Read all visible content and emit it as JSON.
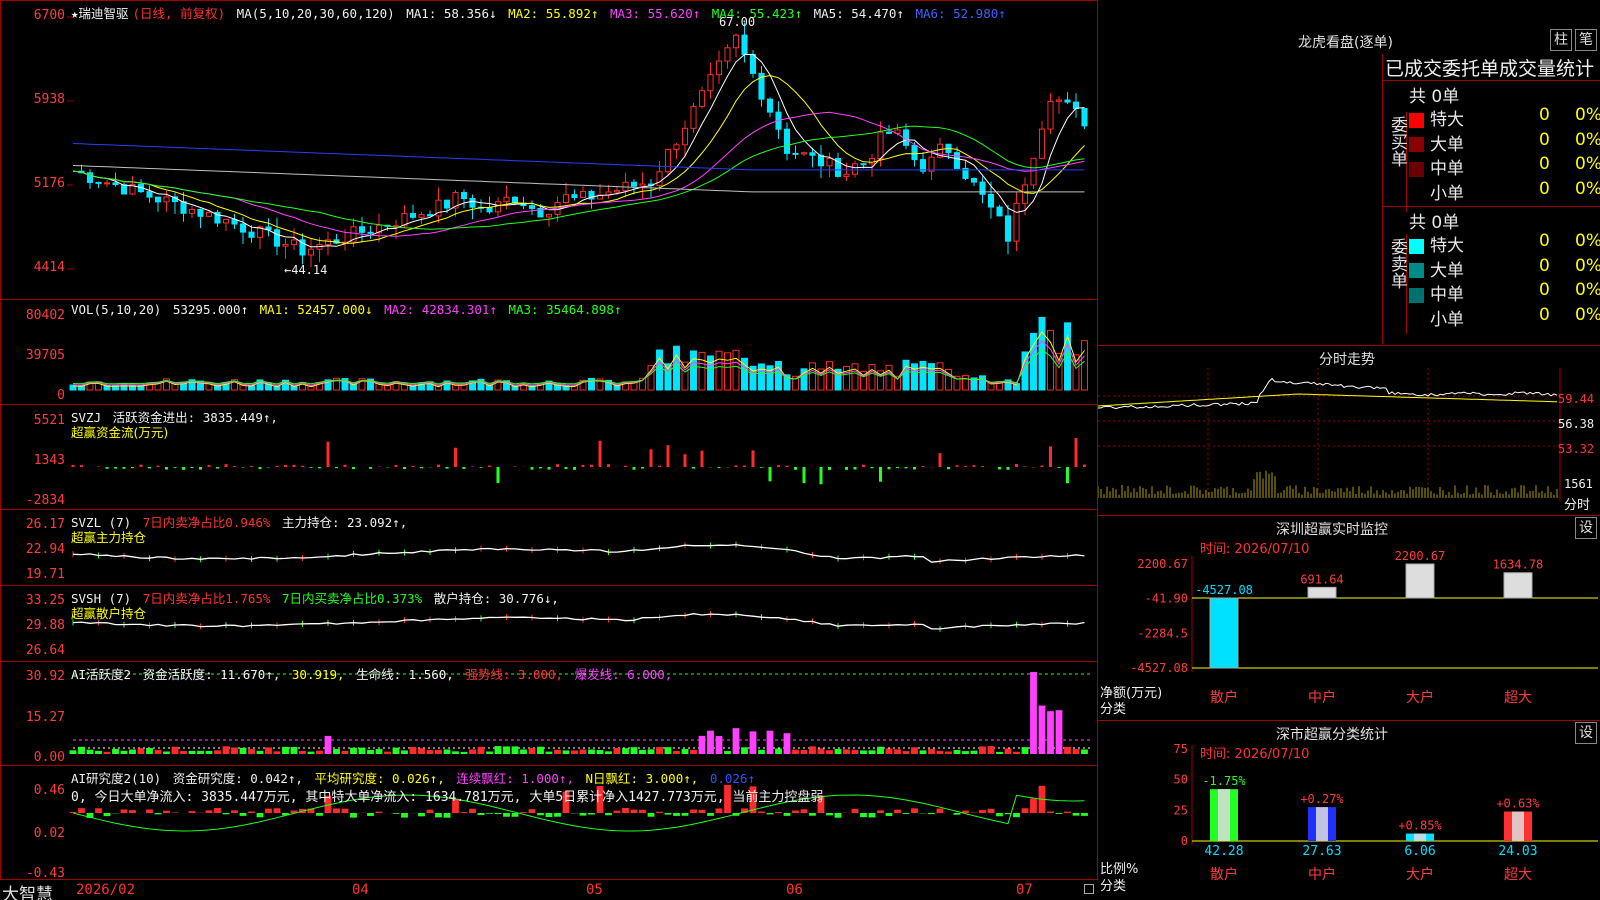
{
  "colors": {
    "up": "#ff2a2a",
    "down": "#00e4ff",
    "grid": "#a00000",
    "ma1": "#ffffff",
    "ma2": "#ffff00",
    "ma3": "#ff40ff",
    "ma4": "#22ff22",
    "ma5": "#c0c0c0",
    "ma6": "#2a3cff"
  },
  "main": {
    "title": "★瑞迪智驱",
    "mode": "(日线, 前复权)",
    "ma_label": "MA(5,10,20,30,60,120)",
    "ma1": "MA1: 58.356↓",
    "ma2": "MA2: 55.892↑",
    "ma3": "MA3: 55.620↑",
    "ma4": "MA4: 55.423↑",
    "ma5": "MA5: 54.470↑",
    "ma6": "MA6: 52.980↑",
    "y_labels": [
      "6700",
      "5938",
      "5176",
      "4414"
    ],
    "high_note": "67.00",
    "low_note": "←44.14"
  },
  "vol": {
    "label": "VOL(5,10,20)",
    "value": "53295.000↑",
    "ma1": "MA1: 52457.000↓",
    "ma2": "MA2: 42834.301↑",
    "ma3": "MA3: 35464.898↑",
    "y_labels": [
      "80402",
      "39705",
      "0"
    ]
  },
  "svzj": {
    "label": "SVZJ",
    "text": "活跃资金进出: 3835.449↑,",
    "sub": "超赢资金流(万元)",
    "y_labels": [
      "5521",
      "1343",
      "-2834"
    ]
  },
  "svzl": {
    "label": "SVZL (7)",
    "red_text": "7日内卖净占比0.946%",
    "white_text": "主力持仓: 23.092↑,",
    "sub": "超赢主力持仓",
    "y_labels": [
      "26.17",
      "22.94",
      "19.71"
    ]
  },
  "svsh": {
    "label": "SVSH (7)",
    "red_text": "7日内卖净占比1.765%",
    "green_text": "7日内买卖净占比0.373%",
    "white_text": "散户持仓: 30.776↓,",
    "sub": "超赢散户持仓",
    "y_labels": [
      "33.25",
      "29.88",
      "26.64"
    ]
  },
  "ai1": {
    "label": "AI活跃度2",
    "t1": "资金活跃度: 11.670↑,",
    "t2": "30.919,",
    "t3": "生命线: 1.560,",
    "t4": "强势线: 3.000,",
    "t5": "爆发线: 6.000,",
    "y_labels": [
      "30.92",
      "15.27",
      "0.00"
    ]
  },
  "ai2": {
    "label": "AI研究度2(10)",
    "t1": "资金研究度: 0.042↑,",
    "t2": "平均研究度: 0.026↑,",
    "t3": "连续飘红: 1.000↑,",
    "t4": "N日飘红: 3.000↑,",
    "t5": "0.026↑",
    "line2": "0, 今日大单净流入: 3835.447万元, 其中特大单净流入: 1634.781万元, 大单5日累计净入1427.773万元, 当前主力控盘弱",
    "y_labels": [
      "0.46",
      "0.02",
      "-0.43"
    ]
  },
  "bottom": {
    "brand": "大智慧",
    "months": [
      "2026/02",
      "04",
      "05",
      "06",
      "07"
    ]
  },
  "dragon": {
    "title": "龙虎看盘(逐单)",
    "btn1": "柱",
    "btn2": "笔",
    "tabs": "已成交委托单成交量统计",
    "buy": {
      "side": "委买单",
      "total": "共 0单",
      "rows": [
        {
          "name": "特大",
          "n": "0",
          "p": "0%",
          "color": "#ff0000"
        },
        {
          "name": "大单",
          "n": "0",
          "p": "0%",
          "color": "#8b0000"
        },
        {
          "name": "中单",
          "n": "0",
          "p": "0%",
          "color": "#6a0000"
        },
        {
          "name": "小单",
          "n": "0",
          "p": "0%",
          "color": "#000000"
        }
      ]
    },
    "sell": {
      "side": "委卖单",
      "total": "共 0单",
      "rows": [
        {
          "name": "特大",
          "n": "0",
          "p": "0%",
          "color": "#00ffff"
        },
        {
          "name": "大单",
          "n": "0",
          "p": "0%",
          "color": "#008b8b"
        },
        {
          "name": "中单",
          "n": "0",
          "p": "0%",
          "color": "#007070"
        },
        {
          "name": "小单",
          "n": "0",
          "p": "0%",
          "color": "#000000"
        }
      ]
    }
  },
  "fenshi": {
    "title": "分时走势",
    "y_labels": [
      "59.44",
      "56.38",
      "53.32"
    ],
    "vol_label": "1561",
    "vol_unit": "分时"
  },
  "monitor": {
    "title": "深圳超赢实时监控",
    "btn": "设",
    "time": "时间: 2026/07/10",
    "y_labels": [
      "2200.67",
      "-41.90",
      "-2284.5",
      "-4527.08"
    ],
    "ylabel": "净额(万元)",
    "xlabel": "分类",
    "categories": [
      "散户",
      "中户",
      "大户",
      "超大"
    ],
    "values": [
      -4527.08,
      691.64,
      2200.67,
      1634.78
    ],
    "value_labels": [
      "-4527.08",
      "691.64",
      "2200.67",
      "1634.78"
    ]
  },
  "stats": {
    "title": "深市超赢分类统计",
    "btn": "设",
    "time": "时间: 2026/07/10",
    "y_labels": [
      "75",
      "50",
      "25",
      "0"
    ],
    "ylabel": "比例%",
    "xlabel": "分类",
    "categories": [
      "散户",
      "中户",
      "大户",
      "超大"
    ],
    "values": [
      42.28,
      27.63,
      6.06,
      24.03
    ],
    "changes": [
      "-1.75%",
      "+0.27%",
      "+0.85%",
      "+0.63%"
    ],
    "value_labels": [
      "42.28",
      "27.63",
      "6.06",
      "24.03"
    ]
  }
}
